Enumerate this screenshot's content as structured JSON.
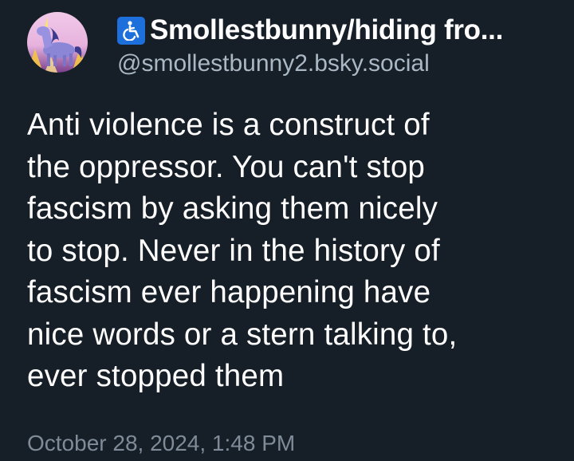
{
  "post": {
    "author": {
      "display_name": "Smollestbunny/hiding fro...",
      "handle": "@smollestbunny2.bsky.social",
      "name_badge_icon": "wheelchair-accessibility-icon",
      "avatar_icon": "unicorn-avatar"
    },
    "text_lines": [
      "Anti violence is a construct of",
      "the oppressor. You can't stop",
      "fascism by asking them nicely",
      "to stop. Never in the history of",
      "fascism ever happening have",
      "nice words or a stern talking to,",
      "ever stopped them"
    ],
    "timestamp": "October 28, 2024, 1:48 PM"
  },
  "colors": {
    "background": "#161e27",
    "text": "#ffffff",
    "handle": "#aab8c5",
    "timestamp": "#7f8b98",
    "badge": "#1d6fdc"
  }
}
